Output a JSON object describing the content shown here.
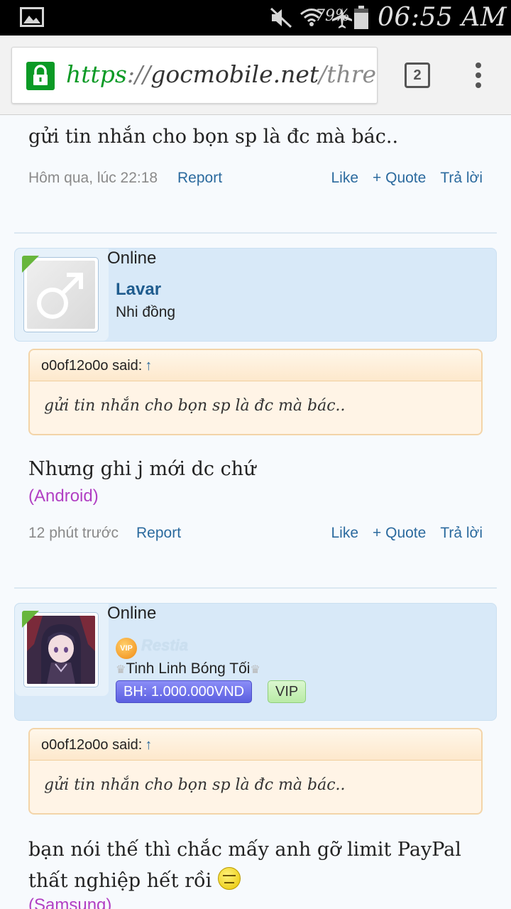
{
  "status_bar": {
    "battery": "79%",
    "time": "06:55 AM",
    "icons": [
      "gallery-icon",
      "mute-icon",
      "wifi-icon",
      "airplane-icon",
      "battery-icon"
    ]
  },
  "browser": {
    "url_scheme": "https",
    "url_sep": "://",
    "url_host": "gocmobile.net",
    "url_path": "/threa",
    "tab_count": "2"
  },
  "posts": [
    {
      "text": "gửi tin nhắn cho bọn sp là đc mà bác..",
      "time": "Hôm qua, lúc 22:18",
      "report": "Report",
      "like": "Like",
      "quote": "+ Quote",
      "reply": "Trả lời"
    },
    {
      "online": "Online",
      "username": "Lavar",
      "user_title": "Nhi đồng",
      "quote_author": "o0of12o0o said:",
      "quote_arrow": "↑",
      "quote_text": "gửi tin nhắn cho bọn sp là đc mà bác..",
      "text": "Nhưng ghi j mới dc chứ",
      "device": "(Android)",
      "time": "12 phút trước",
      "report": "Report",
      "like": "Like",
      "quote": "+ Quote",
      "reply": "Trả lời"
    },
    {
      "online": "Online",
      "vip_badge": "VIP",
      "username": "Restia",
      "user_title": "Tinh Linh Bóng Tối",
      "bh_badge": "BH: 1.000.000VND",
      "vip_tag": "VIP",
      "quote_author": "o0of12o0o said:",
      "quote_arrow": "↑",
      "quote_text": "gửi tin nhắn cho bọn sp là đc mà bác..",
      "text_line1": "bạn nói thế thì chắc mấy anh gỡ limit PayPal",
      "text_line2": "thất nghiệp hết rồi",
      "device": "(Samsung)"
    }
  ],
  "colors": {
    "link": "#2b6a9e",
    "device": "#b13fc3",
    "userbox": "#d8e9f8",
    "online": "#67b63c"
  }
}
